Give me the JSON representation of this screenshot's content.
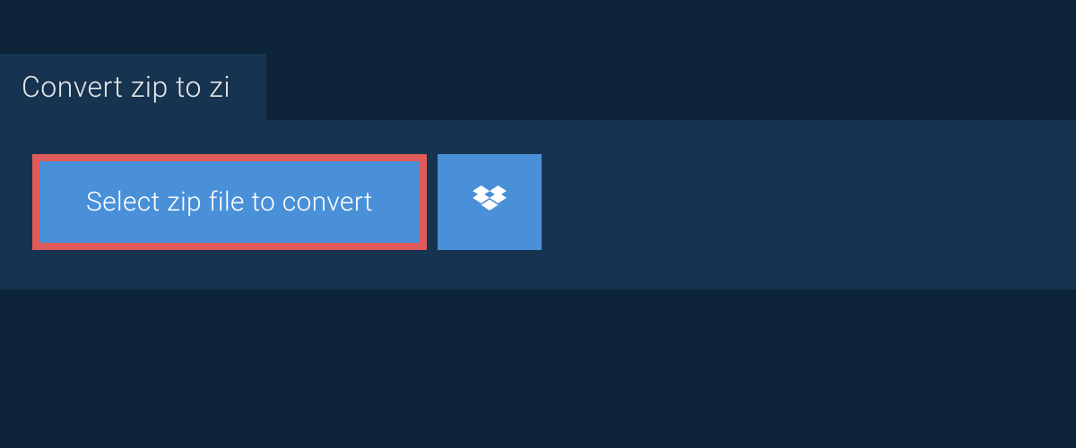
{
  "tab": {
    "label": "Convert zip to zi"
  },
  "actions": {
    "select_file_label": "Select zip file to convert"
  },
  "colors": {
    "background": "#0d2438",
    "panel": "#163450",
    "button": "#4a90d9",
    "highlight_border": "#e05a5a",
    "text_light": "#ffffff"
  },
  "icons": {
    "dropbox": "dropbox-icon"
  }
}
